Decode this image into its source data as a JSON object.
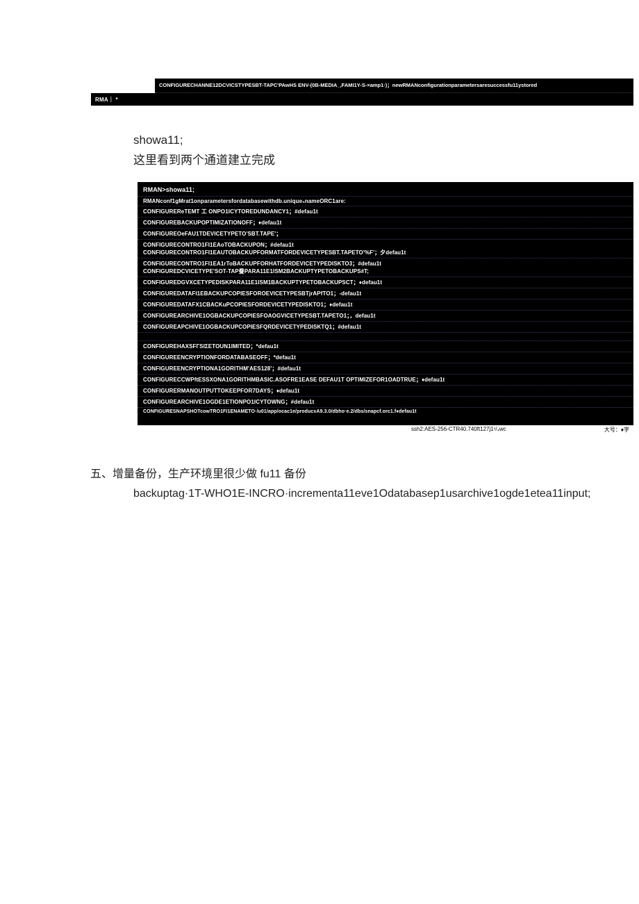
{
  "topBar1": "CONFIGURECHANNE12DCVICSTYPESBT-TAPC'PAwHS ENV-(0B-MEDIA_,FAMI1Y-S-×amp1·)；newRMANconfigurationparametersaresuccessfu11ystored",
  "topBar2": "RMA｜ *",
  "textBlock": {
    "line1": "showa11;",
    "line2": "这里看到两个通道建立完成"
  },
  "terminal": {
    "header": "RMAN>showa11;",
    "lines": [
      "RMANconf1gMrat1onparametersfordatabasewithdb.unique₅nameORC1are:",
      "CONFIGUREReTEMT 工 ONPO1ICYTOREDUNDANCY1；#defau1t",
      "CONFIGUREBACKUPOPTIMIZATIONOFF；♦defau1t",
      "CONFIGUREOeFAU1TDEVICETYPETO'SBT.TAPE'；",
      "CONFIGURECONTRO1FI1EAoTOBACKUPON；#defau1t",
      "CONFIGURECONTRO1FI1EAUTOBACKUPFORMATFORDEVICETYPESBT.TAPETO'%F'；夕defau1t",
      "CONFIGURECONTRO1FI1EA1rToBACKUPFORHATFORDEVICETYPEDISKTO3；#defau1t",
      "CONFIGUREDCVICETYPE'SOT-TAP疂PARA11E1ISM2BACKUPTYPETOBACKUPS#T;",
      "CONFIGUREDGVXCETYPEDISKPARA11E1ISM1BACKUPTYPETOBACKUPSCT；♦defau1t",
      "CONFIGUREDATAFI1EBACKUPCOPIESFOROEVICETYPESBTjrAPfTO1；-defau1t",
      "CONFIGUREDATAFX1CBACKuPCOPIESFORDEVICETYPEDISKTO1；♦defau1t",
      "CONFIGUREARCHIVE1OGBACKUPCOPIESFOAOGVICETYPESBT.TAPETO1；，defau1t",
      "CONFIGUREAPCHIVE1OGBACKUPCOPIESFQRDEVICETYPEDISKTQ1；#defau1t",
      "",
      "CONFIGUREHAXSFГSIΣETOUN1IMITED；*defau1t",
      "CONFIGUREENCRYPTIONFORDATABASEOFF；*defau1t",
      "CONFIGUREENCRYPTIONA1GORITHM'AES128'；#defau1t",
      "CONFIGURECCWPftESSXONA1GORITHMBASIC.ASOFRE1EASE DEFAU1T OPTIMIZEFOR1OADTRUE；♦defau1t",
      "CONFIGURERMANOUTPUTTOKEEPFOR7DAYS；♦defau1t",
      "CONFIGUREARCHIVE1OGDE1ETIONPO1ICYTOWNG；#defau1t"
    ],
    "lastLine": "CONFIGURESNAPSHOTcowTRO1FI1ENAMETO·/u01/app/ocac1e/producxA9.3.0/dbho·e.2/dbs/snapcf.orc1.f♦defau1t"
  },
  "statusBar": {
    "left": "ssh2:AES-256-CTR40.740ft127j1¹/₄wc",
    "right": "大号：♦字"
  },
  "sectionHeading": "五、增量备份，生产环境里很少做 fu11 备份",
  "sectionBody": "backuptag·1T-WHO1E-INCRO·incrementa11eve1Odatabasep1usarchive1ogde1etea11input;"
}
